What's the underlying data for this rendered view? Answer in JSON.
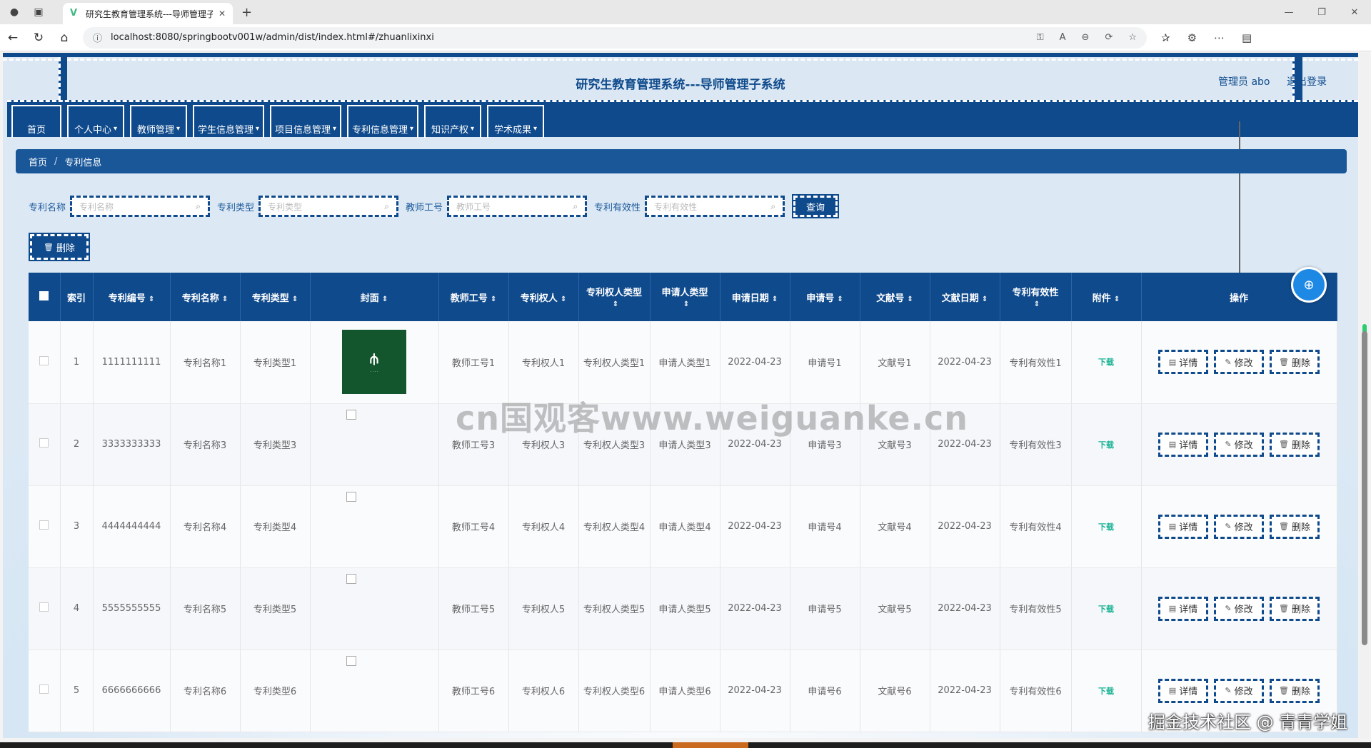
{
  "browser": {
    "tab_title": "研究生教育管理系统---导师管理子",
    "url": "localhost:8080/springbootv001w/admin/dist/index.html#/zhuanlixinxi"
  },
  "header": {
    "title": "研究生教育管理系统---导师管理子系统",
    "user": "管理员 abo",
    "logout": "退出登录"
  },
  "menu": [
    {
      "label": "首页"
    },
    {
      "label": "个人中心"
    },
    {
      "label": "教师管理"
    },
    {
      "label": "学生信息管理"
    },
    {
      "label": "项目信息管理"
    },
    {
      "label": "专利信息管理"
    },
    {
      "label": "知识产权"
    },
    {
      "label": "学术成果"
    }
  ],
  "breadcrumb": {
    "home": "首页",
    "current": "专利信息"
  },
  "search": {
    "patent_name_label": "专利名称",
    "patent_name_placeholder": "专利名称",
    "patent_type_label": "专利类型",
    "patent_type_placeholder": "专利类型",
    "teacher_id_label": "教师工号",
    "teacher_id_placeholder": "教师工号",
    "validity_label": "专利有效性",
    "validity_placeholder": "专利有效性",
    "query_button": "查询"
  },
  "batch_delete": "删除",
  "table": {
    "headers": [
      "索引",
      "专利编号",
      "专利名称",
      "专利类型",
      "封面",
      "教师工号",
      "专利权人",
      "专利权人类型",
      "申请人类型",
      "申请日期",
      "申请号",
      "文献号",
      "文献日期",
      "专利有效性",
      "附件",
      "操作"
    ],
    "rows": [
      {
        "index": "1",
        "number": "1111111111",
        "name": "专利名称1",
        "type": "专利类型1",
        "teacher": "教师工号1",
        "holder": "专利权人1",
        "holder_type": "专利权人类型1",
        "applicant_type": "申请人类型1",
        "apply_date": "2022-04-23",
        "apply_no": "申请号1",
        "doc_no": "文献号1",
        "doc_date": "2022-04-23",
        "validity": "专利有效性1",
        "attachment": "下载"
      },
      {
        "index": "2",
        "number": "3333333333",
        "name": "专利名称3",
        "type": "专利类型3",
        "teacher": "教师工号3",
        "holder": "专利权人3",
        "holder_type": "专利权人类型3",
        "applicant_type": "申请人类型3",
        "apply_date": "2022-04-23",
        "apply_no": "申请号3",
        "doc_no": "文献号3",
        "doc_date": "2022-04-23",
        "validity": "专利有效性3",
        "attachment": "下载"
      },
      {
        "index": "3",
        "number": "4444444444",
        "name": "专利名称4",
        "type": "专利类型4",
        "teacher": "教师工号4",
        "holder": "专利权人4",
        "holder_type": "专利权人类型4",
        "applicant_type": "申请人类型4",
        "apply_date": "2022-04-23",
        "apply_no": "申请号4",
        "doc_no": "文献号4",
        "doc_date": "2022-04-23",
        "validity": "专利有效性4",
        "attachment": "下载"
      },
      {
        "index": "4",
        "number": "5555555555",
        "name": "专利名称5",
        "type": "专利类型5",
        "teacher": "教师工号5",
        "holder": "专利权人5",
        "holder_type": "专利权人类型5",
        "applicant_type": "申请人类型5",
        "apply_date": "2022-04-23",
        "apply_no": "申请号5",
        "doc_no": "文献号5",
        "doc_date": "2022-04-23",
        "validity": "专利有效性5",
        "attachment": "下载"
      },
      {
        "index": "5",
        "number": "6666666666",
        "name": "专利名称6",
        "type": "专利类型6",
        "teacher": "教师工号6",
        "holder": "专利权人6",
        "holder_type": "专利权人类型6",
        "applicant_type": "申请人类型6",
        "apply_date": "2022-04-23",
        "apply_no": "申请号6",
        "doc_no": "文献号6",
        "doc_date": "2022-04-23",
        "validity": "专利有效性6",
        "attachment": "下载"
      }
    ],
    "actions": {
      "detail": "详情",
      "edit": "修改",
      "delete": "删除"
    }
  },
  "overlays": {
    "watermark": "cn国观客www.weiguanke.cn",
    "footer_mark": "掘金技术社区 @ 青青学姐"
  },
  "colors": {
    "primary": "#0f4a8c",
    "breadcrumb": "#1a5799",
    "download": "#1ab394"
  }
}
